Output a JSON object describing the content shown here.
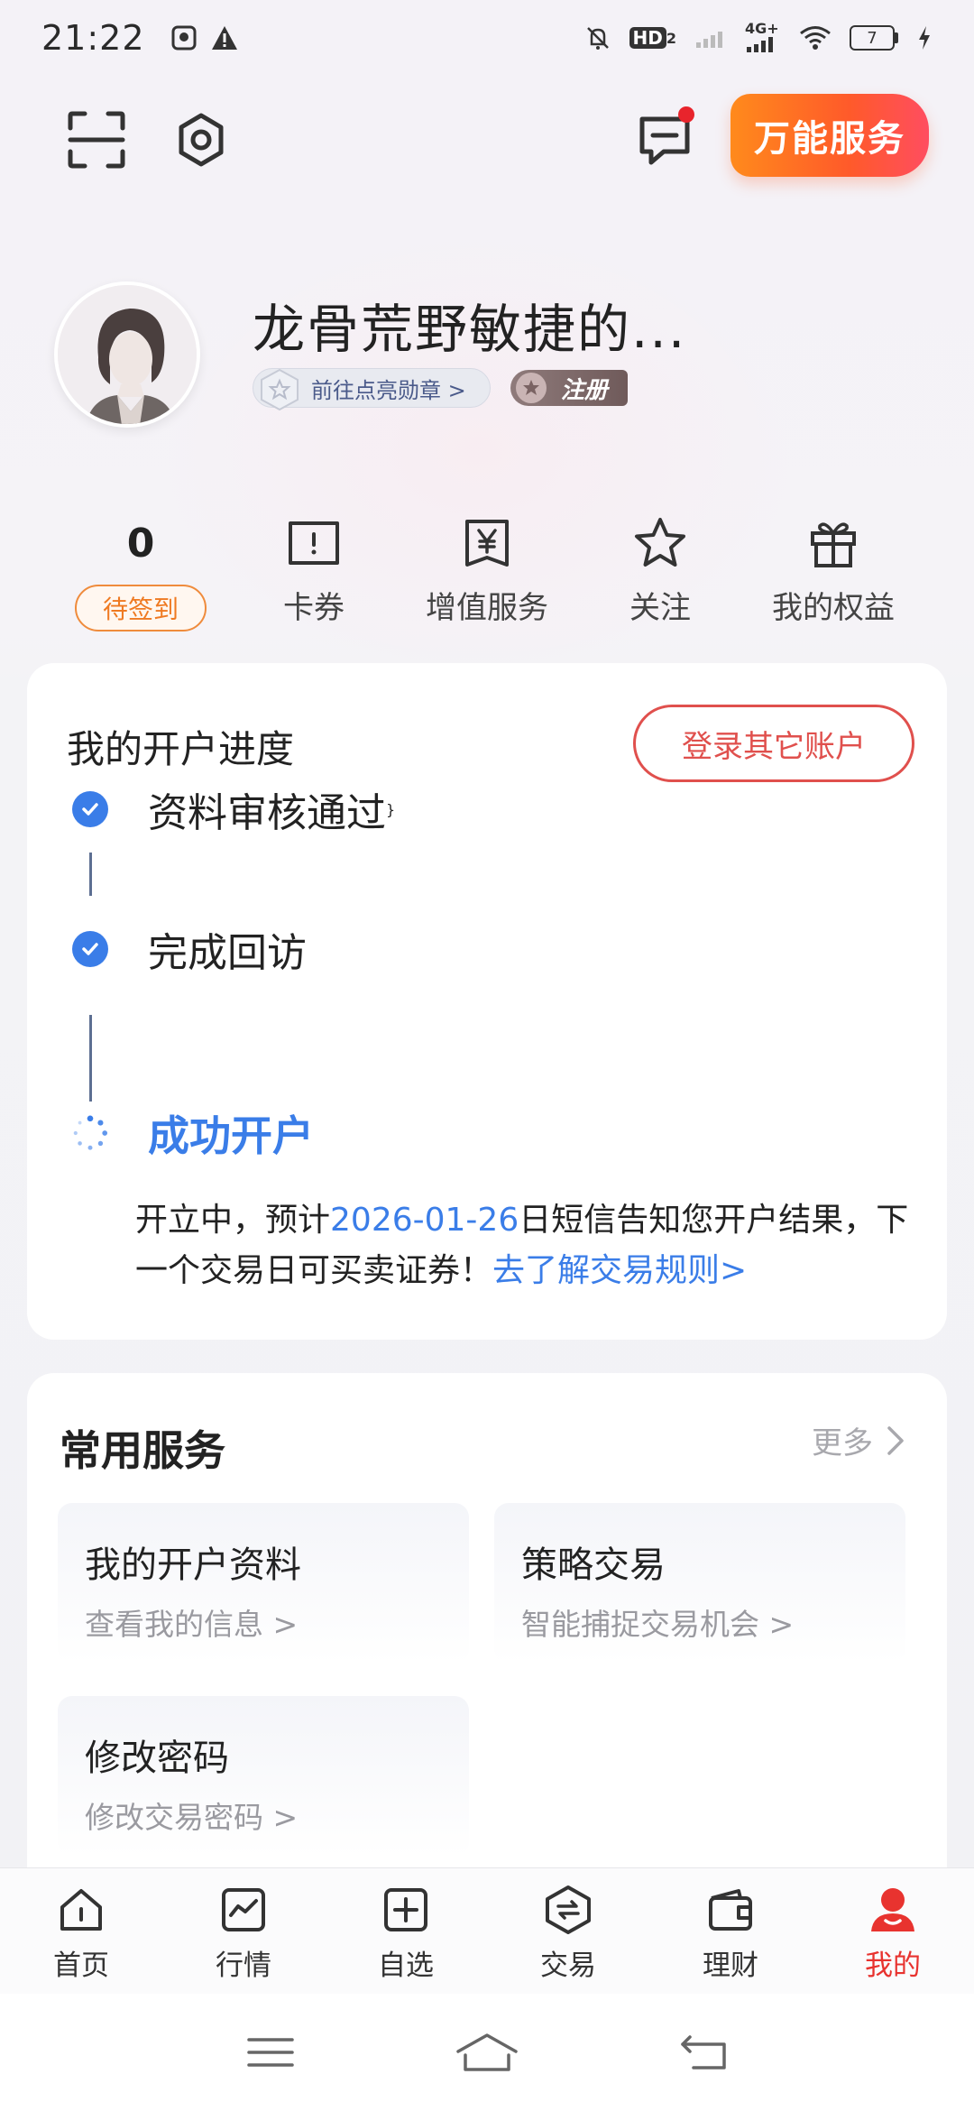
{
  "status": {
    "time": "21:22",
    "net_label": "HD",
    "net_sub": "2",
    "cell_label": "4G+",
    "battery": "7"
  },
  "topbar": {
    "service_label": "万能服务"
  },
  "profile": {
    "name": "龙骨荒野敏捷的...",
    "medal_label": "前往点亮勋章 >",
    "register_label": "注册"
  },
  "stats": {
    "points_value": "0",
    "checkin_label": "待签到",
    "items": [
      {
        "label": "卡券",
        "icon": "coupon-icon"
      },
      {
        "label": "增值服务",
        "icon": "yen-icon"
      },
      {
        "label": "关注",
        "icon": "star-icon"
      },
      {
        "label": "我的权益",
        "icon": "gift-icon"
      }
    ]
  },
  "progress": {
    "title": "我的开户进度",
    "login_other": "登录其它账户",
    "steps": [
      {
        "label": "资料审核通过",
        "state": "done"
      },
      {
        "label": "完成回访",
        "state": "done"
      },
      {
        "label": "成功开户",
        "state": "pending"
      }
    ],
    "desc_prefix": "开立中，预计",
    "desc_date": "2026-01-26",
    "desc_suffix": "日短信告知您开户结果，下一个交易日可买卖证券！",
    "desc_link": "去了解交易规则>"
  },
  "services": {
    "title": "常用服务",
    "more": "更多",
    "tiles": [
      {
        "title": "我的开户资料",
        "sub": "查看我的信息 >"
      },
      {
        "title": "策略交易",
        "sub": "智能捕捉交易机会 >"
      },
      {
        "title": "修改密码",
        "sub": "修改交易密码 >"
      }
    ]
  },
  "tabbar": {
    "active_color": "#e8332f",
    "items": [
      {
        "label": "首页",
        "icon": "home-icon"
      },
      {
        "label": "行情",
        "icon": "market-icon"
      },
      {
        "label": "自选",
        "icon": "watchlist-icon"
      },
      {
        "label": "交易",
        "icon": "trade-icon"
      },
      {
        "label": "理财",
        "icon": "wallet-icon"
      },
      {
        "label": "我的",
        "icon": "profile-icon"
      }
    ]
  }
}
